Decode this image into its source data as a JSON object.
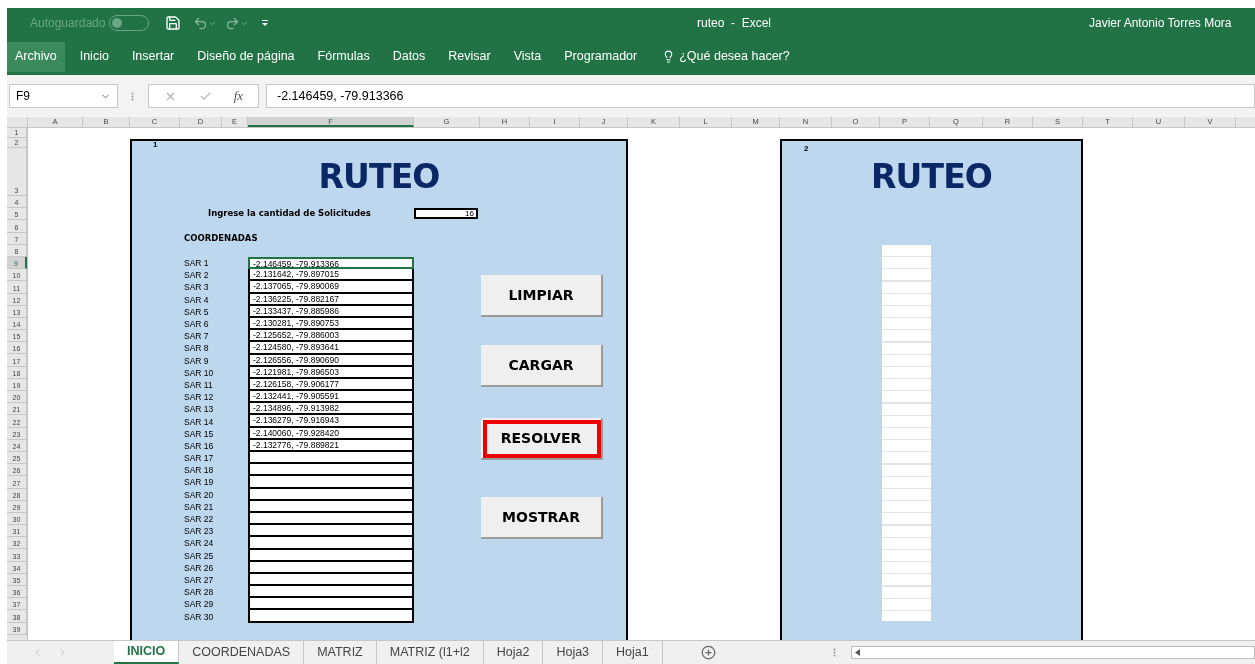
{
  "window": {
    "title": "ruteo  -  Excel",
    "user": "Javier Antonio Torres Mora"
  },
  "quick_access": {
    "autosave": {
      "label": "Autoguardado",
      "on": false
    }
  },
  "ribbon_tabs": [
    {
      "label": "Archivo",
      "selected": true
    },
    {
      "label": "Inicio",
      "selected": false
    },
    {
      "label": "Insertar",
      "selected": false
    },
    {
      "label": "Diseño de página",
      "selected": false
    },
    {
      "label": "Fórmulas",
      "selected": false
    },
    {
      "label": "Datos",
      "selected": false
    },
    {
      "label": "Revisar",
      "selected": false
    },
    {
      "label": "Vista",
      "selected": false
    },
    {
      "label": "Programador",
      "selected": false
    }
  ],
  "tell_me": {
    "placeholder": "¿Qué desea hacer?"
  },
  "formula_bar": {
    "name_box": "F9",
    "function_label": "fx",
    "value": "-2.146459, -79.913366"
  },
  "columns": [
    {
      "label": "A",
      "selected": false
    },
    {
      "label": "B",
      "selected": false
    },
    {
      "label": "C",
      "selected": false
    },
    {
      "label": "D",
      "selected": false
    },
    {
      "label": "E",
      "selected": false
    },
    {
      "label": "F",
      "selected": true
    },
    {
      "label": "G",
      "selected": false
    },
    {
      "label": "H",
      "selected": false
    },
    {
      "label": "I",
      "selected": false
    },
    {
      "label": "J",
      "selected": false
    },
    {
      "label": "K",
      "selected": false
    },
    {
      "label": "L",
      "selected": false
    },
    {
      "label": "M",
      "selected": false
    },
    {
      "label": "N",
      "selected": false
    },
    {
      "label": "O",
      "selected": false
    },
    {
      "label": "P",
      "selected": false
    },
    {
      "label": "Q",
      "selected": false
    },
    {
      "label": "R",
      "selected": false
    },
    {
      "label": "S",
      "selected": false
    },
    {
      "label": "T",
      "selected": false
    },
    {
      "label": "U",
      "selected": false
    },
    {
      "label": "V",
      "selected": false
    }
  ],
  "rows": [
    {
      "label": "1",
      "selected": false
    },
    {
      "label": "2",
      "selected": false
    },
    {
      "label": "3",
      "selected": false
    },
    {
      "label": "4",
      "selected": false
    },
    {
      "label": "5",
      "selected": false
    },
    {
      "label": "6",
      "selected": false
    },
    {
      "label": "7",
      "selected": false
    },
    {
      "label": "8",
      "selected": false
    },
    {
      "label": "9",
      "selected": true
    },
    {
      "label": "10",
      "selected": false
    },
    {
      "label": "11",
      "selected": false
    },
    {
      "label": "12",
      "selected": false
    },
    {
      "label": "13",
      "selected": false
    },
    {
      "label": "14",
      "selected": false
    },
    {
      "label": "15",
      "selected": false
    },
    {
      "label": "16",
      "selected": false
    },
    {
      "label": "17",
      "selected": false
    },
    {
      "label": "18",
      "selected": false
    },
    {
      "label": "19",
      "selected": false
    },
    {
      "label": "20",
      "selected": false
    },
    {
      "label": "21",
      "selected": false
    },
    {
      "label": "22",
      "selected": false
    },
    {
      "label": "23",
      "selected": false
    },
    {
      "label": "24",
      "selected": false
    },
    {
      "label": "25",
      "selected": false
    },
    {
      "label": "26",
      "selected": false
    },
    {
      "label": "27",
      "selected": false
    },
    {
      "label": "28",
      "selected": false
    },
    {
      "label": "29",
      "selected": false
    },
    {
      "label": "30",
      "selected": false
    },
    {
      "label": "31",
      "selected": false
    },
    {
      "label": "32",
      "selected": false
    },
    {
      "label": "33",
      "selected": false
    },
    {
      "label": "34",
      "selected": false
    },
    {
      "label": "35",
      "selected": false
    },
    {
      "label": "36",
      "selected": false
    },
    {
      "label": "37",
      "selected": false
    },
    {
      "label": "38",
      "selected": false
    },
    {
      "label": "39",
      "selected": false
    }
  ],
  "panel_1": {
    "number": "1",
    "title": "RUTEO",
    "prompt": "Ingrese la cantidad de Solicitudes",
    "count": "16",
    "section": "COORDENADAS",
    "entries": [
      {
        "label": "SAR 1",
        "value": "-2.146459, -79.913366",
        "selected": true
      },
      {
        "label": "SAR 2",
        "value": "-2.131642, -79.897015",
        "selected": false
      },
      {
        "label": "SAR 3",
        "value": "-2.137065, -79.890069",
        "selected": false
      },
      {
        "label": "SAR 4",
        "value": "-2.136225, -79.882167",
        "selected": false
      },
      {
        "label": "SAR 5",
        "value": "-2.133437, -79.885986",
        "selected": false
      },
      {
        "label": "SAR 6",
        "value": "-2.130281, -79.890753",
        "selected": false
      },
      {
        "label": "SAR 7",
        "value": "-2.125652, -79.886003",
        "selected": false
      },
      {
        "label": "SAR 8",
        "value": "-2.124580, -79.893641",
        "selected": false
      },
      {
        "label": "SAR 9",
        "value": "-2.126556, -79.890690",
        "selected": false
      },
      {
        "label": "SAR 10",
        "value": "-2.121981, -79.896503",
        "selected": false
      },
      {
        "label": "SAR 11",
        "value": "-2.126158, -79.906177",
        "selected": false
      },
      {
        "label": "SAR 12",
        "value": "-2.132441, -79.905591",
        "selected": false
      },
      {
        "label": "SAR 13",
        "value": "-2.134896, -79.913982",
        "selected": false
      },
      {
        "label": "SAR 14",
        "value": "-2.136279, -79.916943",
        "selected": false
      },
      {
        "label": "SAR 15",
        "value": "-2.140060, -79.928420",
        "selected": false
      },
      {
        "label": "SAR 16",
        "value": "-2.132776, -79.889821",
        "selected": false
      },
      {
        "label": "SAR 17",
        "selected": false
      },
      {
        "label": "SAR 18",
        "selected": false
      },
      {
        "label": "SAR 19",
        "selected": false
      },
      {
        "label": "SAR 20",
        "selected": false
      },
      {
        "label": "SAR 21",
        "selected": false
      },
      {
        "label": "SAR 22",
        "selected": false
      },
      {
        "label": "SAR 23",
        "selected": false
      },
      {
        "label": "SAR 24",
        "selected": false
      },
      {
        "label": "SAR 25",
        "selected": false
      },
      {
        "label": "SAR 26",
        "selected": false
      },
      {
        "label": "SAR 27",
        "selected": false
      },
      {
        "label": "SAR 28",
        "selected": false
      },
      {
        "label": "SAR 29",
        "selected": false
      },
      {
        "label": "SAR 30",
        "selected": false
      }
    ],
    "buttons": [
      {
        "label": "LIMPIAR",
        "highlighted": false
      },
      {
        "label": "CARGAR",
        "highlighted": false
      },
      {
        "label": "RESOLVER",
        "highlighted": true
      },
      {
        "label": "MOSTRAR",
        "highlighted": false
      }
    ]
  },
  "panel_2": {
    "number": "2",
    "title": "RUTEO"
  },
  "sheet_tabs": [
    {
      "label": "INICIO",
      "selected": true
    },
    {
      "label": "COORDENADAS",
      "selected": false
    },
    {
      "label": "MATRIZ",
      "selected": false
    },
    {
      "label": "MATRIZ (l1+l2",
      "selected": false
    },
    {
      "label": "Hoja2",
      "selected": false
    },
    {
      "label": "Hoja3",
      "selected": false
    },
    {
      "label": "Hoja1",
      "selected": false
    }
  ]
}
